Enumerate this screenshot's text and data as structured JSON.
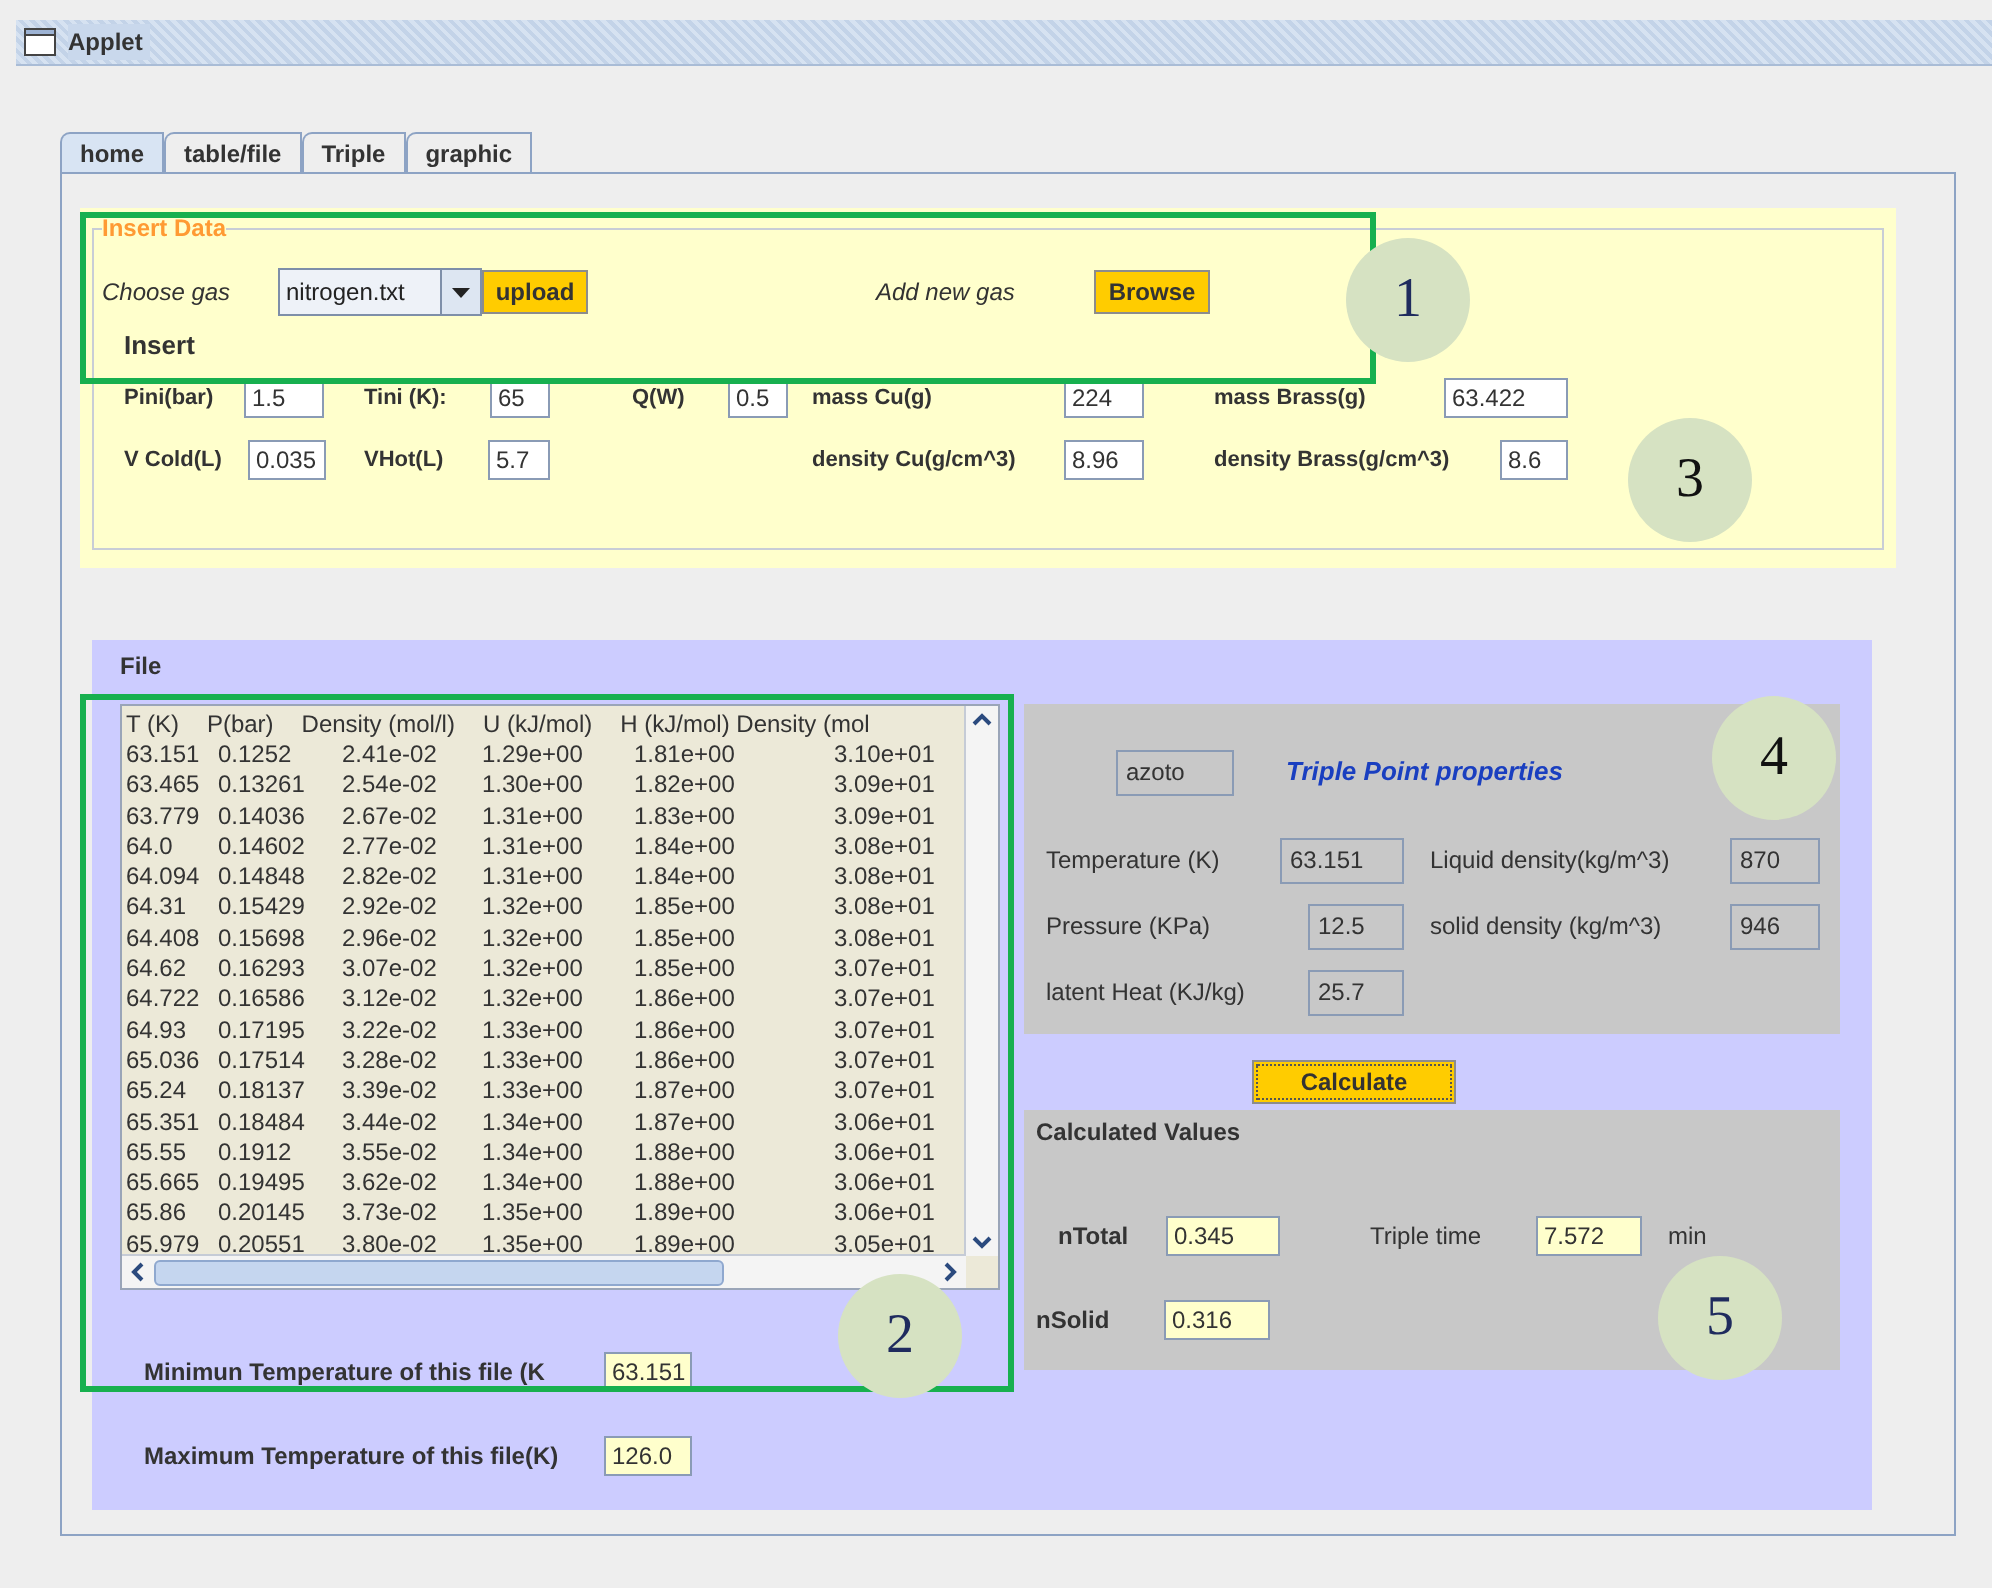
{
  "window": {
    "title": "Applet"
  },
  "tabs": [
    {
      "label": "home",
      "selected": true
    },
    {
      "label": "table/file",
      "selected": false
    },
    {
      "label": "Triple",
      "selected": false
    },
    {
      "label": "graphic",
      "selected": false
    }
  ],
  "insert_data": {
    "title": "Insert Data",
    "choose_gas_label": "Choose gas",
    "gas_select": {
      "value": "nitrogen.txt"
    },
    "upload_button": "upload",
    "add_new_gas_label": "Add new  gas",
    "browse_button": "Browse",
    "insert_heading": "Insert",
    "row_1": [
      {
        "label": "Pini(bar)",
        "value": "1.5"
      },
      {
        "label": "Tini  (K):",
        "value": "65"
      },
      {
        "label": "Q(W)",
        "value": "0.5"
      },
      {
        "label": "mass Cu(g)",
        "value": "224"
      },
      {
        "label": "mass Brass(g)",
        "value": "63.422"
      }
    ],
    "row_2": [
      {
        "label": "V Cold(L)",
        "value": "0.035"
      },
      {
        "label": "VHot(L)",
        "value": "5.7"
      },
      {
        "label": "density Cu(g/cm^3)",
        "value": "8.96"
      },
      {
        "label": "density Brass(g/cm^3)",
        "value": "8.6"
      }
    ]
  },
  "file": {
    "title": "File",
    "table_header": [
      "T (K)",
      "P(bar)",
      "Density (mol/l)",
      "U (kJ/mol)",
      "H (kJ/mol) Density (mol"
    ],
    "table_rows": [
      [
        "63.151",
        "0.1252",
        "2.41e-02",
        "1.29e+00",
        "1.81e+00",
        "3.10e+01"
      ],
      [
        "63.465",
        "0.13261",
        "2.54e-02",
        "1.30e+00",
        "1.82e+00",
        "3.09e+01"
      ],
      [
        "63.779",
        "0.14036",
        "2.67e-02",
        "1.31e+00",
        "1.83e+00",
        "3.09e+01"
      ],
      [
        "64.0",
        "0.14602",
        "2.77e-02",
        "1.31e+00",
        "1.84e+00",
        "3.08e+01"
      ],
      [
        "64.094",
        "0.14848",
        "2.82e-02",
        "1.31e+00",
        "1.84e+00",
        "3.08e+01"
      ],
      [
        "64.31",
        "0.15429",
        "2.92e-02",
        "1.32e+00",
        "1.85e+00",
        "3.08e+01"
      ],
      [
        "64.408",
        "0.15698",
        "2.96e-02",
        "1.32e+00",
        "1.85e+00",
        "3.08e+01"
      ],
      [
        "64.62",
        "0.16293",
        "3.07e-02",
        "1.32e+00",
        "1.85e+00",
        "3.07e+01"
      ],
      [
        "64.722",
        "0.16586",
        "3.12e-02",
        "1.32e+00",
        "1.86e+00",
        "3.07e+01"
      ],
      [
        "64.93",
        "0.17195",
        "3.22e-02",
        "1.33e+00",
        "1.86e+00",
        "3.07e+01"
      ],
      [
        "65.036",
        "0.17514",
        "3.28e-02",
        "1.33e+00",
        "1.86e+00",
        "3.07e+01"
      ],
      [
        "65.24",
        "0.18137",
        "3.39e-02",
        "1.33e+00",
        "1.87e+00",
        "3.07e+01"
      ],
      [
        "65.351",
        "0.18484",
        "3.44e-02",
        "1.34e+00",
        "1.87e+00",
        "3.06e+01"
      ],
      [
        "65.55",
        "0.1912",
        "3.55e-02",
        "1.34e+00",
        "1.88e+00",
        "3.06e+01"
      ],
      [
        "65.665",
        "0.19495",
        "3.62e-02",
        "1.34e+00",
        "1.88e+00",
        "3.06e+01"
      ],
      [
        "65.86",
        "0.20145",
        "3.73e-02",
        "1.35e+00",
        "1.89e+00",
        "3.06e+01"
      ],
      [
        "65.979",
        "0.20551",
        "3.80e-02",
        "1.35e+00",
        "1.89e+00",
        "3.05e+01"
      ]
    ],
    "min_temp": {
      "label": "Minimun Temperature of this file (K",
      "value": "63.151"
    },
    "max_temp": {
      "label": "Maximum Temperature of this file(K)",
      "value": "126.0"
    }
  },
  "triple_point": {
    "gas_name": "azoto",
    "title": "Triple Point properties",
    "fields": [
      {
        "label": "Temperature (K)",
        "value": "63.151"
      },
      {
        "label": "Liquid density(kg/m^3)",
        "value": "870"
      },
      {
        "label": "Pressure (KPa)",
        "value": "12.5"
      },
      {
        "label": "solid density (kg/m^3)",
        "value": "946"
      },
      {
        "label": "latent Heat (KJ/kg)",
        "value": "25.7"
      }
    ]
  },
  "calculate_button": "Calculate",
  "calculated_values": {
    "title": "Calculated Values",
    "ntotal": {
      "label": "nTotal",
      "value": "0.345"
    },
    "triple_time": {
      "label": "Triple time",
      "value": "7.572",
      "unit": "min"
    },
    "nsolid": {
      "label": "nSolid",
      "value": "0.316"
    }
  },
  "annotations": [
    {
      "label": "1"
    },
    {
      "label": "3"
    },
    {
      "label": "2"
    },
    {
      "label": "4"
    },
    {
      "label": "5"
    }
  ]
}
